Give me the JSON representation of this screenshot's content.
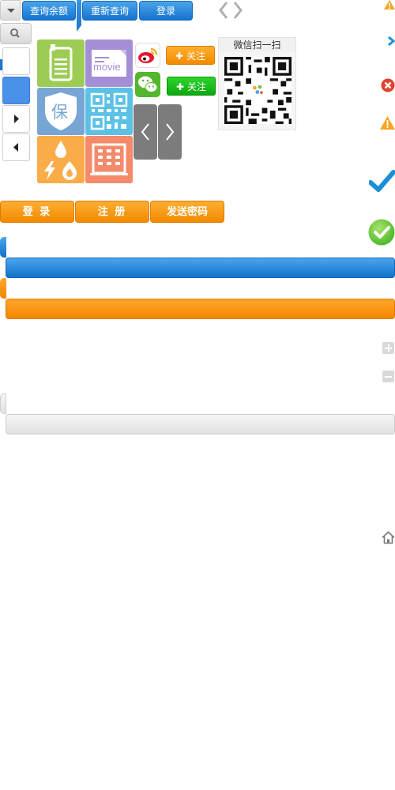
{
  "toolbar": {
    "check_balance": "查询余额",
    "requery": "重新查询",
    "login": "登录"
  },
  "tiles": {
    "movie_text": "movie",
    "baozhang_char": "保"
  },
  "social": {
    "follow_weibo": "关注",
    "follow_wechat": "关注"
  },
  "qr": {
    "title": "微信扫一扫"
  },
  "form_buttons": {
    "login": "登 录",
    "register": "注 册",
    "send_password": "发送密码"
  },
  "colors": {
    "accent_blue": "#1574cf",
    "accent_orange": "#f48a00",
    "success_green": "#57c22e",
    "error_red": "#e2412b",
    "warning_yellow": "#f5a623"
  }
}
